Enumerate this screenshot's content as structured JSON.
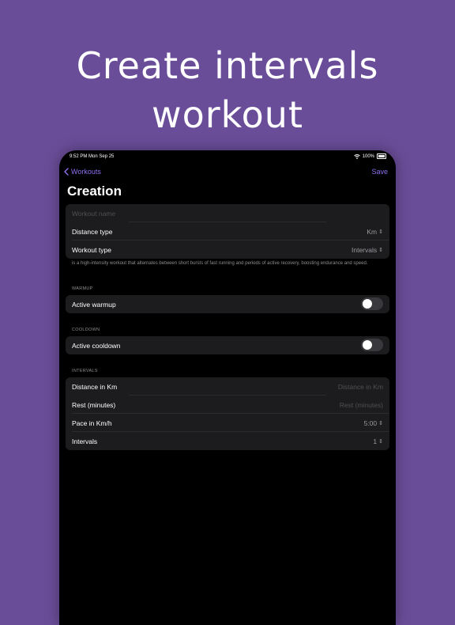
{
  "headline": {
    "line1": "Create intervals",
    "line2": "workout"
  },
  "status_bar": {
    "time": "9:52 PM  Mon Sep 25",
    "battery": "100%"
  },
  "nav": {
    "back_label": "Workouts",
    "save_label": "Save"
  },
  "page_title": "Creation",
  "form": {
    "workout_name_placeholder": "Workout name",
    "distance_type_label": "Distance type",
    "distance_type_value": "Km",
    "workout_type_label": "Workout type",
    "workout_type_value": "Intervals",
    "description": "is a high-intensity workout that alternates between short bursts of fast running and periods of active recovery, boosting endurance and speed."
  },
  "warmup": {
    "section_label": "WARMUP",
    "label": "Active warmup",
    "enabled": false
  },
  "cooldown": {
    "section_label": "COOLDOWN",
    "label": "Active cooldown",
    "enabled": false
  },
  "intervals": {
    "section_label": "INTERVALS",
    "distance_label": "Distance in Km",
    "distance_placeholder": "Distance in Km",
    "rest_label": "Rest (minutes)",
    "rest_placeholder": "Rest (minutes)",
    "pace_label": "Pace in Km/h",
    "pace_value": "5:00",
    "count_label": "Intervals",
    "count_value": "1"
  },
  "colors": {
    "background": "#6a4d98",
    "accent": "#8f6ff0",
    "device": "#000000",
    "group": "#1c1c1e"
  },
  "icons": [
    "chevron-left-icon",
    "wifi-icon",
    "battery-icon",
    "chevron-updown-icon"
  ]
}
